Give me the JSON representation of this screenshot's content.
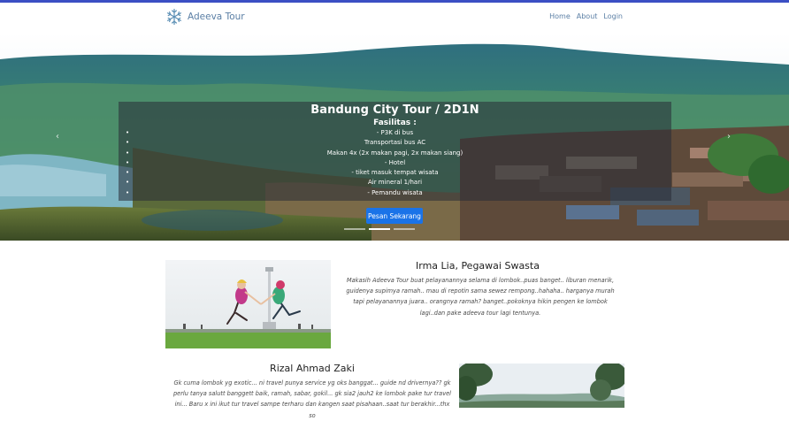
{
  "nav": {
    "brand": "Adeeva Tour",
    "links": [
      "Home",
      "About",
      "Login"
    ]
  },
  "hero": {
    "title": "Bandung City Tour / 2D1N",
    "facilities_heading": "Fasilitas :",
    "facilities": [
      "- P3K di bus",
      "Transportasi bus AC",
      "Makan 4x (2x makan pagi, 2x makan siang)",
      "- Hotel",
      "- tiket masuk tempat wisata",
      "Air mineral 1/hari",
      "- Pemandu wisata"
    ],
    "cta": "Pesan Sekarang",
    "prev_icon": "‹",
    "next_icon": "›",
    "slide_count": 3,
    "active_slide": 1
  },
  "testimonials": [
    {
      "name": "Irma Lia, Pegawai Swasta",
      "quote": "Makasih Adeeva Tour buat pelayanannya selama di lombok..puas banget.. liburan menarik, guidenya supimya ramah.. mau di repotin sama sewez rempong..hahaha.. harganya murah tapi pelayanannya juara.. orangnya ramah? banget..pokoknya hikin pengen ke lombok lagi..dan pake adeeva tour lagi tentunya."
    },
    {
      "name": "Rizal Ahmad Zaki",
      "quote": "Gk cuma lombok yg exotic... ni travel punya service yg oks banggat... guide nd drivernya?? gk perlu tanya salutt banggett baik, ramah, sabar, gokil... gk sia2 jauh2 ke lombok pake tur travel ini... Baru x ini ikut tur travel sampe terharu dan kangen saat pisahaan..saat tur berakhir...thx so"
    }
  ],
  "colors": {
    "accent": "#1a73e8",
    "nav_text": "#5b7fa5",
    "top_border": "#3b4fc4"
  }
}
